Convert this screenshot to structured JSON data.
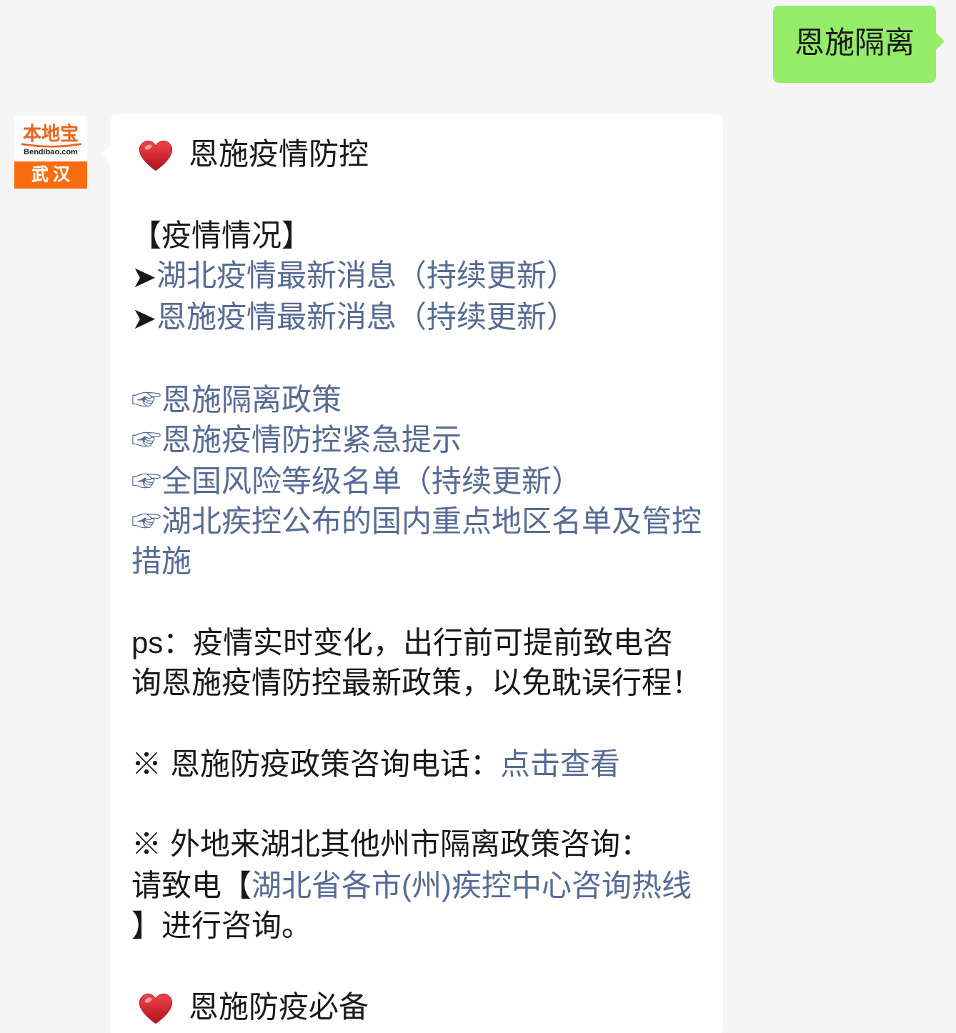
{
  "conversation": {
    "messages": [
      {
        "kind": "outgoing",
        "text": "恩施隔离"
      },
      {
        "kind": "incoming",
        "avatar": {
          "brand": "本地宝",
          "domain": "Bendibao.com",
          "city": "武汉"
        },
        "sections": [
          [
            {
              "kind": "heading",
              "text": "恩施疫情防控"
            }
          ],
          [
            {
              "kind": "line",
              "parts": [
                {
                  "kind": "text",
                  "text": "【疫情情况】"
                }
              ]
            },
            {
              "kind": "line",
              "parts": [
                {
                  "kind": "bullet",
                  "text": "➤"
                },
                {
                  "kind": "link",
                  "text": "湖北疫情最新消息（持续更新）"
                }
              ]
            },
            {
              "kind": "line",
              "parts": [
                {
                  "kind": "bullet",
                  "text": "➤"
                },
                {
                  "kind": "link",
                  "text": "恩施疫情最新消息（持续更新）"
                }
              ]
            }
          ],
          [
            {
              "kind": "line",
              "parts": [
                {
                  "kind": "link",
                  "text": "☞恩施隔离政策"
                }
              ]
            },
            {
              "kind": "line",
              "parts": [
                {
                  "kind": "link",
                  "text": "☞恩施疫情防控紧急提示"
                }
              ]
            },
            {
              "kind": "line",
              "parts": [
                {
                  "kind": "link",
                  "text": "☞全国风险等级名单（持续更新）"
                }
              ]
            },
            {
              "kind": "line",
              "parts": [
                {
                  "kind": "link",
                  "text": "☞湖北疾控公布的国内重点地区名单及管控措施"
                }
              ]
            }
          ],
          [
            {
              "kind": "line",
              "parts": [
                {
                  "kind": "text",
                  "text": "ps：疫情实时变化，出行前可提前致电咨询恩施疫情防控最新政策，以免耽误行程！"
                }
              ]
            }
          ],
          [
            {
              "kind": "line",
              "parts": [
                {
                  "kind": "text",
                  "text": "※ 恩施防疫政策咨询电话："
                },
                {
                  "kind": "link",
                  "text": "点击查看"
                }
              ]
            }
          ],
          [
            {
              "kind": "line",
              "parts": [
                {
                  "kind": "text",
                  "text": "※ 外地来湖北其他州市隔离政策咨询："
                }
              ]
            },
            {
              "kind": "line",
              "parts": [
                {
                  "kind": "text",
                  "text": "请致电【"
                },
                {
                  "kind": "link",
                  "text": "湖北省各市(州)疾控中心咨询热线"
                },
                {
                  "kind": "text",
                  "text": "】进行咨询。"
                }
              ]
            }
          ],
          [
            {
              "kind": "heading",
              "text": "恩施防疫必备"
            }
          ]
        ]
      }
    ]
  }
}
